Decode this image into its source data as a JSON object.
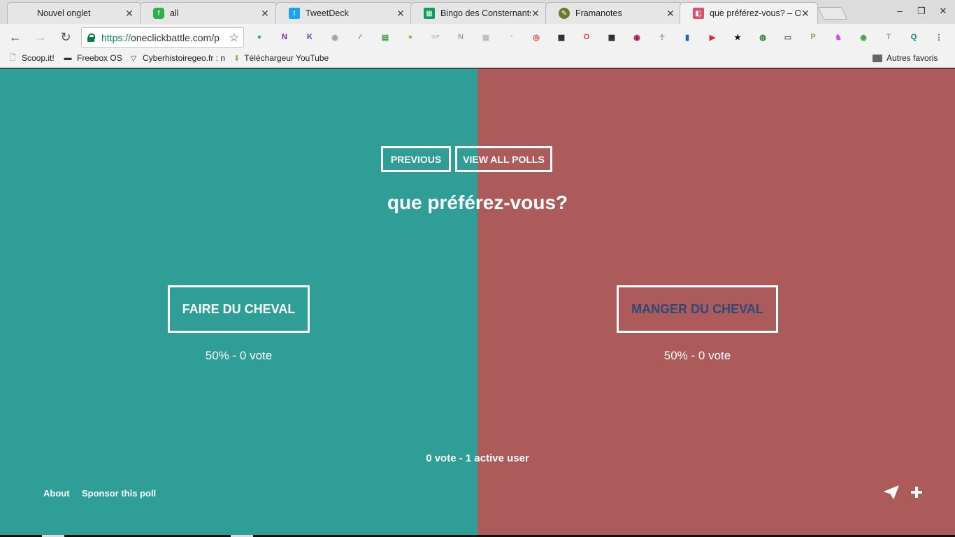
{
  "tabs": [
    {
      "title": "Nouvel onglet",
      "icon": "blank-page-icon",
      "active": false
    },
    {
      "title": "all",
      "icon": "feedly-icon",
      "color": "#2bb24c",
      "active": false
    },
    {
      "title": "TweetDeck",
      "icon": "twitter-icon",
      "color": "#1da1f2",
      "active": false
    },
    {
      "title": "Bingo des Consternants",
      "icon": "google-sheets-icon",
      "color": "#0f9d58",
      "active": false
    },
    {
      "title": "Framanotes",
      "icon": "framanotes-icon",
      "color": "#6a7b2c",
      "active": false
    },
    {
      "title": "que préférez-vous? – On",
      "icon": "oneclickbattle-icon",
      "color": "#e04e6a",
      "active": true
    }
  ],
  "tab_close_glyph": "✕",
  "window_controls": {
    "minimize": "–",
    "restore": "❐",
    "close": "✕"
  },
  "address": {
    "scheme": "https://",
    "host": "oneclickbattle.com/p"
  },
  "extensions": [
    {
      "name": "evernote-icon",
      "color": "#2dbe60",
      "glyph": "●"
    },
    {
      "name": "onenote-icon",
      "color": "#7719aa",
      "glyph": "N"
    },
    {
      "name": "klout-icon",
      "color": "#3949ab",
      "glyph": "K"
    },
    {
      "name": "camera-icon",
      "color": "#9e9e9e",
      "glyph": "◉"
    },
    {
      "name": "quill-icon",
      "color": "#7e57c2",
      "glyph": "⁄"
    },
    {
      "name": "print-icon",
      "color": "#43a047",
      "glyph": "▤"
    },
    {
      "name": "green-dot-icon",
      "color": "#8bc34a",
      "glyph": "●"
    },
    {
      "name": "gif-icon",
      "color": "#bdbdbd",
      "glyph": "GIF"
    },
    {
      "name": "notion-icon",
      "color": "#9e9e9e",
      "glyph": "N"
    },
    {
      "name": "reader-icon",
      "color": "#bdbdbd",
      "glyph": "▦"
    },
    {
      "name": "rss-icon",
      "color": "#bdbdbd",
      "glyph": "◔"
    },
    {
      "name": "broadcast-icon",
      "color": "#e53935",
      "glyph": "◎"
    },
    {
      "name": "qr-code-icon",
      "color": "#212121",
      "glyph": "▩"
    },
    {
      "name": "opera-icon",
      "color": "#e53935",
      "glyph": "O"
    },
    {
      "name": "qr-scanner-icon",
      "color": "#212121",
      "glyph": "▩"
    },
    {
      "name": "donut-icon",
      "color": "#ad1457",
      "glyph": "◉"
    },
    {
      "name": "ankh-icon",
      "color": "#9e9e9e",
      "glyph": "☥"
    },
    {
      "name": "book-icon",
      "color": "#1565c0",
      "glyph": "▮"
    },
    {
      "name": "video-icon",
      "color": "#d32f2f",
      "glyph": "▶"
    },
    {
      "name": "star-icon",
      "color": "#111111",
      "glyph": "★"
    },
    {
      "name": "turtle-icon",
      "color": "#2e7d32",
      "glyph": "◍"
    },
    {
      "name": "cast-icon",
      "color": "#616161",
      "glyph": "▭"
    },
    {
      "name": "pdf-icon",
      "color": "#7cb342",
      "glyph": "P"
    },
    {
      "name": "unicorn-icon",
      "color": "#e040fb",
      "glyph": "♞"
    },
    {
      "name": "eye-icon",
      "color": "#43a047",
      "glyph": "◉"
    },
    {
      "name": "text-icon",
      "color": "#9e9e9e",
      "glyph": "T"
    },
    {
      "name": "search-ext-icon",
      "color": "#00897b",
      "glyph": "Q"
    },
    {
      "name": "menu-icon",
      "color": "#555555",
      "glyph": "⋮"
    }
  ],
  "bookmarks": [
    {
      "label": "Scoop.it!",
      "icon": "page-icon",
      "glyph": "🗋"
    },
    {
      "label": "Freebox OS",
      "icon": "freebox-icon",
      "glyph": "▬"
    },
    {
      "label": "Cyberhistoiregeo.fr : n",
      "icon": "fox-icon",
      "glyph": "▽"
    },
    {
      "label": "Téléchargeur YouTube",
      "icon": "download-icon",
      "glyph": "⬇"
    }
  ],
  "other_bookmarks": "Autres favoris",
  "poll": {
    "previous_label": "PREVIOUS",
    "view_all_label": "VIEW ALL POLLS",
    "question": "que préférez-vous?",
    "left": {
      "choice": "FAIRE DU CHEVAL",
      "result": "50% - 0 vote",
      "color": "#2e9e96"
    },
    "right": {
      "choice": "MANGER DU CHEVAL",
      "result": "50% - 0 vote",
      "color": "#ad5a5a",
      "text_color": "#2a4a7a"
    },
    "totals": "0 vote - 1 active user",
    "footer": {
      "about": "About",
      "sponsor": "Sponsor this poll"
    }
  }
}
